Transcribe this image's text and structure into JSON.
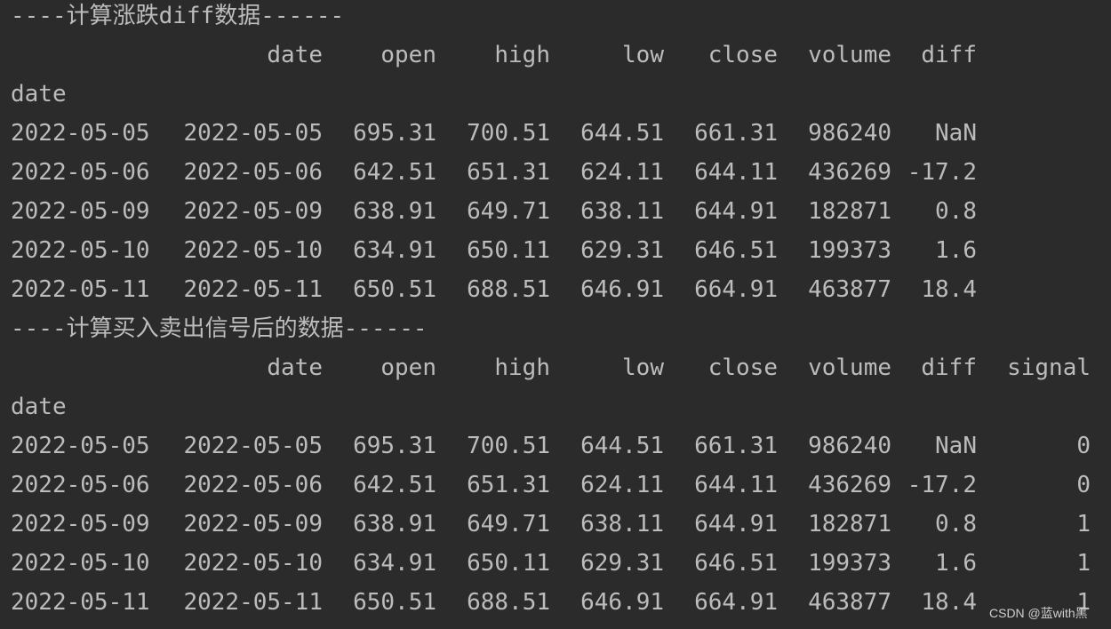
{
  "sections": [
    {
      "title": "----计算涨跌diff数据------",
      "index_name": "date",
      "columns": [
        "date",
        "open",
        "high",
        "low",
        "close",
        "volume",
        "diff"
      ],
      "rows": [
        [
          "2022-05-05",
          "2022-05-05",
          "695.31",
          "700.51",
          "644.51",
          "661.31",
          "986240",
          "NaN"
        ],
        [
          "2022-05-06",
          "2022-05-06",
          "642.51",
          "651.31",
          "624.11",
          "644.11",
          "436269",
          "-17.2"
        ],
        [
          "2022-05-09",
          "2022-05-09",
          "638.91",
          "649.71",
          "638.11",
          "644.91",
          "182871",
          "0.8"
        ],
        [
          "2022-05-10",
          "2022-05-10",
          "634.91",
          "650.11",
          "629.31",
          "646.51",
          "199373",
          "1.6"
        ],
        [
          "2022-05-11",
          "2022-05-11",
          "650.51",
          "688.51",
          "646.91",
          "664.91",
          "463877",
          "18.4"
        ]
      ]
    },
    {
      "title": "----计算买入卖出信号后的数据------",
      "index_name": "date",
      "columns": [
        "date",
        "open",
        "high",
        "low",
        "close",
        "volume",
        "diff",
        "signal"
      ],
      "rows": [
        [
          "2022-05-05",
          "2022-05-05",
          "695.31",
          "700.51",
          "644.51",
          "661.31",
          "986240",
          "NaN",
          "0"
        ],
        [
          "2022-05-06",
          "2022-05-06",
          "642.51",
          "651.31",
          "624.11",
          "644.11",
          "436269",
          "-17.2",
          "0"
        ],
        [
          "2022-05-09",
          "2022-05-09",
          "638.91",
          "649.71",
          "638.11",
          "644.91",
          "182871",
          "0.8",
          "1"
        ],
        [
          "2022-05-10",
          "2022-05-10",
          "634.91",
          "650.11",
          "629.31",
          "646.51",
          "199373",
          "1.6",
          "1"
        ],
        [
          "2022-05-11",
          "2022-05-11",
          "650.51",
          "688.51",
          "646.91",
          "664.91",
          "463877",
          "18.4",
          "1"
        ]
      ]
    }
  ],
  "watermark": "CSDN @蓝with黑",
  "colors": {
    "background": "#2b2b2b",
    "text": "#bcbcbc"
  }
}
